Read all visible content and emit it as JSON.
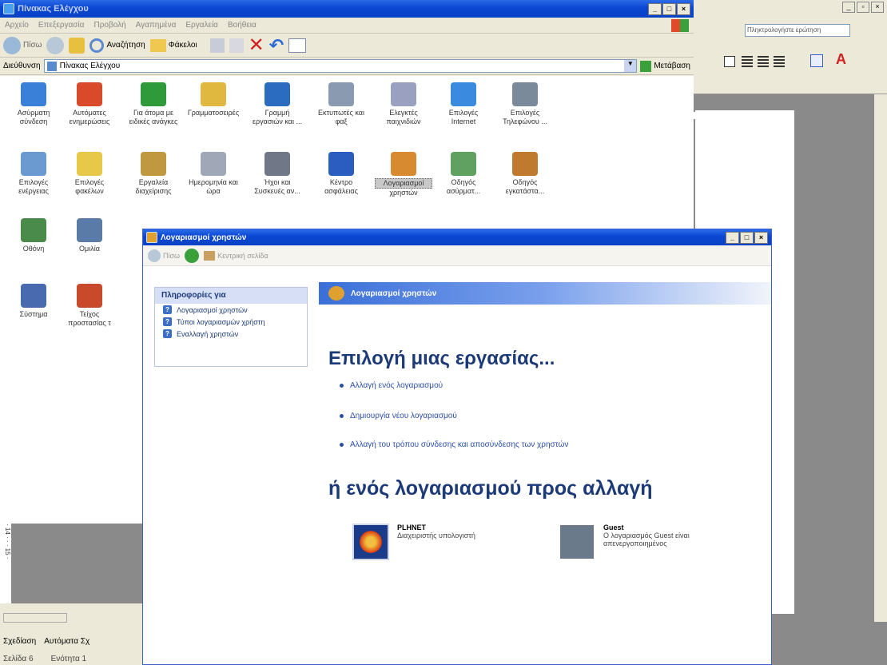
{
  "control_panel": {
    "title": "Πίνακας Ελέγχου",
    "menu": [
      "Αρχείο",
      "Επεξεργασία",
      "Προβολή",
      "Αγαπημένα",
      "Εργαλεία",
      "Βοήθεια"
    ],
    "toolbar": {
      "back": "Πίσω",
      "search": "Αναζήτηση",
      "folders": "Φάκελοι"
    },
    "address_label": "Διεύθυνση",
    "address_value": "Πίνακας Ελέγχου",
    "go_label": "Μετάβαση",
    "items": [
      {
        "line1": "Ασύρματη",
        "line2": "σύνδεση",
        "color": "#3a7fd8"
      },
      {
        "line1": "Αυτόματες",
        "line2": "ενημερώσεις",
        "color": "#d84a2a"
      },
      {
        "line1": "Για άτομα με",
        "line2": "ειδικές ανάγκες",
        "color": "#2e9a3a"
      },
      {
        "line1": "Γραμματοσειρές",
        "line2": "",
        "color": "#e0b840"
      },
      {
        "line1": "Γραμμή",
        "line2": "εργασιών και ...",
        "color": "#2b6cc0"
      },
      {
        "line1": "Εκτυπωτές και",
        "line2": "φαξ",
        "color": "#8a9ab0"
      },
      {
        "line1": "Ελεγκτές",
        "line2": "παιχνιδιών",
        "color": "#9aa0c0"
      },
      {
        "line1": "Επιλογές",
        "line2": "Internet",
        "color": "#3a8ae0"
      },
      {
        "line1": "Επιλογές",
        "line2": "Τηλεφώνου ...",
        "color": "#7a8a9a"
      },
      {
        "line1": "Επιλογές",
        "line2": "ενέργειας",
        "color": "#6a9ad0"
      },
      {
        "line1": "Επιλογές",
        "line2": "φακέλων",
        "color": "#e8c848"
      },
      {
        "line1": "Εργαλεία",
        "line2": "διαχείρισης",
        "color": "#c09840"
      },
      {
        "line1": "Ημερομηνία και",
        "line2": "ώρα",
        "color": "#a0a8b8"
      },
      {
        "line1": "Ήχοι και",
        "line2": "Συσκευές αν...",
        "color": "#707888"
      },
      {
        "line1": "Κέντρο",
        "line2": "ασφάλειας",
        "color": "#2b5cc0"
      },
      {
        "line1": "Λογαριασμοί",
        "line2": "χρηστών",
        "color": "#d88a30"
      },
      {
        "line1": "Οδηγός",
        "line2": "ασύρματ...",
        "color": "#60a060"
      },
      {
        "line1": "Οδηγός",
        "line2": "εγκατάστα...",
        "color": "#c07a30"
      },
      {
        "line1": "Οθόνη",
        "line2": "",
        "color": "#4a8a4a"
      },
      {
        "line1": "Ομιλία",
        "line2": "",
        "color": "#5a7aa8"
      },
      {
        "line1": "Σύστημα",
        "line2": "",
        "color": "#4a6ab0"
      },
      {
        "line1": "Τείχος",
        "line2": "προστασίας τ",
        "color": "#c84a2a"
      }
    ]
  },
  "user_accounts": {
    "title": "Λογαριασμοί χρηστών",
    "nav_back": "Πίσω",
    "nav_home": "Κεντρική σελίδα",
    "side_header": "Πληροφορίες για",
    "side_links": [
      "Λογαριασμοί χρηστών",
      "Τύποι λογαριασμών χρήστη",
      "Εναλλαγή χρηστών"
    ],
    "band_title": "Λογαριασμοί χρηστών",
    "heading1": "Επιλογή μιας εργασίας...",
    "tasks": [
      "Αλλαγή ενός λογαριασμού",
      "Δημιουργία νέου λογαριασμού",
      "Αλλαγή του τρόπου σύνδεσης και αποσύνδεσης των χρηστών"
    ],
    "heading2": "ή ενός λογαριασμού προς αλλαγή",
    "accounts": [
      {
        "name": "PLHNET",
        "desc": "Διαχειριστής υπολογιστή"
      },
      {
        "name": "Guest",
        "desc": "Ο λογαριασμός Guest είναι απενεργοποιημένος"
      }
    ]
  },
  "word": {
    "help_box": "Πληκτρολογήστε ερώτηση",
    "draw_label": "Σχεδίαση",
    "autoshapes_label": "Αυτόματα Σχ",
    "status_page": "Σελίδα 6",
    "status_section": "Ενότητα 1",
    "ruler_left": "· 14 · · · 15 ·"
  }
}
